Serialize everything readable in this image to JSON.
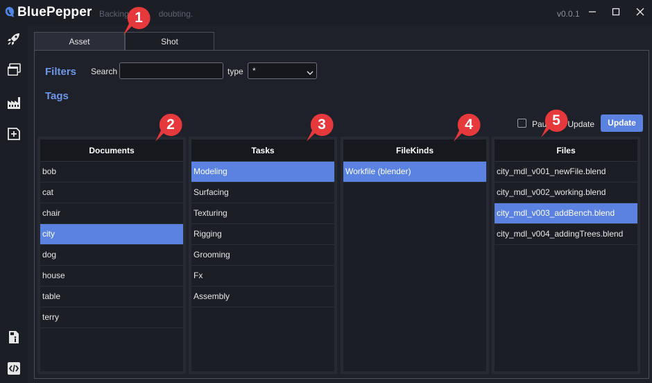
{
  "app": {
    "title": "BluePepper",
    "subtitle": "Backing",
    "subtitle_tail": "doubting.",
    "version": "v0.0.1"
  },
  "window_controls": [
    "minimize-icon",
    "maximize-icon",
    "close-icon"
  ],
  "sidebar": {
    "icons": [
      "rocket-icon",
      "windows-icon",
      "factory-icon",
      "add-document-icon",
      "file-info-icon",
      "code-icon"
    ]
  },
  "tabs": [
    {
      "label": "Asset",
      "active": true
    },
    {
      "label": "Shot",
      "active": false
    }
  ],
  "filters": {
    "label": "Filters",
    "search_label": "Search",
    "search_value": "",
    "type_label": "type",
    "type_value": "*"
  },
  "tags": {
    "label": "Tags"
  },
  "update_controls": {
    "pause_label": "Pau",
    "pause_tail": "Update",
    "pause_checked": false,
    "update_button": "Update"
  },
  "columns": {
    "documents": {
      "header": "Documents",
      "items": [
        "bob",
        "cat",
        "chair",
        "city",
        "dog",
        "house",
        "table",
        "terry"
      ],
      "selected": "city"
    },
    "tasks": {
      "header": "Tasks",
      "items": [
        "Modeling",
        "Surfacing",
        "Texturing",
        "Rigging",
        "Grooming",
        "Fx",
        "Assembly"
      ],
      "selected": "Modeling"
    },
    "filekinds": {
      "header": "FileKinds",
      "items": [
        "Workfile (blender)"
      ],
      "selected": "Workfile (blender)"
    },
    "files": {
      "header": "Files",
      "items": [
        "city_mdl_v001_newFile.blend",
        "city_mdl_v002_working.blend",
        "city_mdl_v003_addBench.blend",
        "city_mdl_v004_addingTrees.blend"
      ],
      "selected": "city_mdl_v003_addBench.blend"
    }
  },
  "callouts": [
    "1",
    "2",
    "3",
    "4",
    "5"
  ],
  "colors": {
    "accent": "#5b82e0",
    "label_blue": "#6e97e8",
    "callout_red": "#e5393b",
    "background": "#1e2129"
  }
}
